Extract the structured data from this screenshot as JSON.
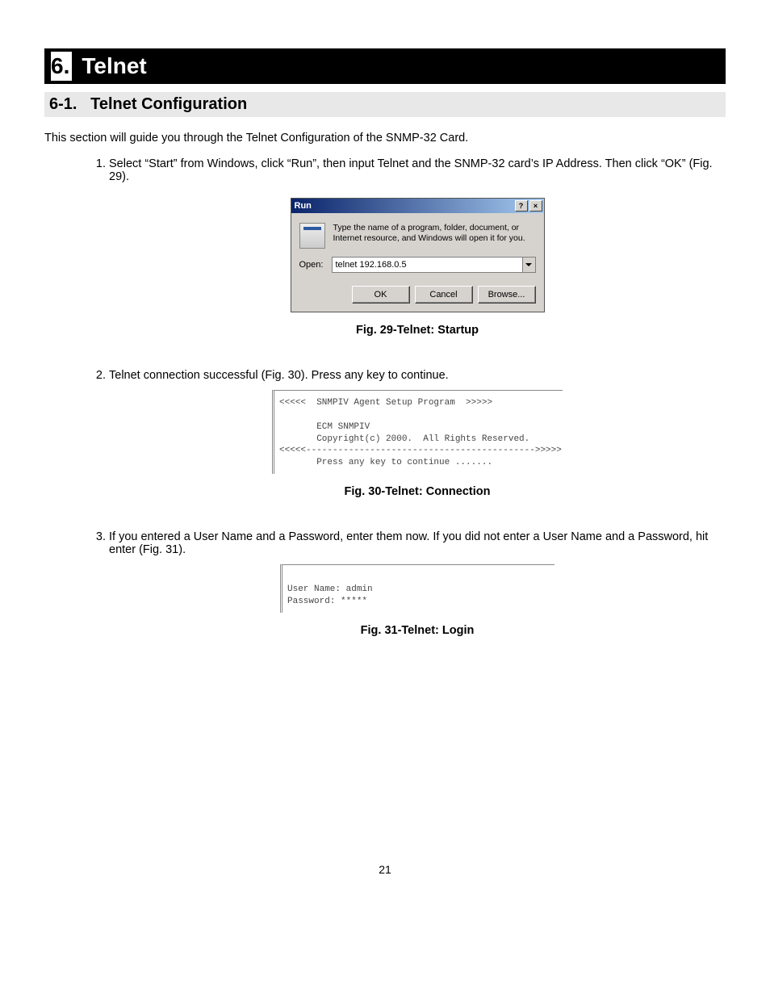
{
  "chapter": {
    "number": "6.",
    "title": "Telnet"
  },
  "section": {
    "number": "6-1.",
    "title": "Telnet Configuration"
  },
  "intro": "This section will guide you through the Telnet Configuration of the SNMP-32 Card.",
  "steps": {
    "s1": "Select “Start” from Windows, click “Run”, then input Telnet and the SNMP-32 card’s IP Address.  Then click “OK” (Fig. 29).",
    "s2": "Telnet connection successful (Fig. 30).  Press any key to continue.",
    "s3": "If you entered a User Name and a Password, enter them now.  If you did not enter a User Name and a Password, hit enter (Fig. 31)."
  },
  "run_dialog": {
    "title": "Run",
    "help_btn": "?",
    "close_btn": "×",
    "desc": "Type the name of a program, folder, document, or Internet resource, and Windows will open it for you.",
    "open_label": "Open:",
    "open_value": "telnet 192.168.0.5",
    "ok": "OK",
    "cancel": "Cancel",
    "browse": "Browse..."
  },
  "captions": {
    "fig29": "Fig. 29-Telnet: Startup",
    "fig30": "Fig. 30-Telnet: Connection",
    "fig31": "Fig. 31-Telnet: Login"
  },
  "console_fig30": "<<<<<  SNMPIV Agent Setup Program  >>>>>\n\n       ECM SNMPIV\n       Copyright(c) 2000.  All Rights Reserved.\n<<<<<------------------------------------------->>>>>\n       Press any key to continue .......",
  "console_fig31": "\nUser Name: admin\nPassword: *****",
  "page_number": "21"
}
